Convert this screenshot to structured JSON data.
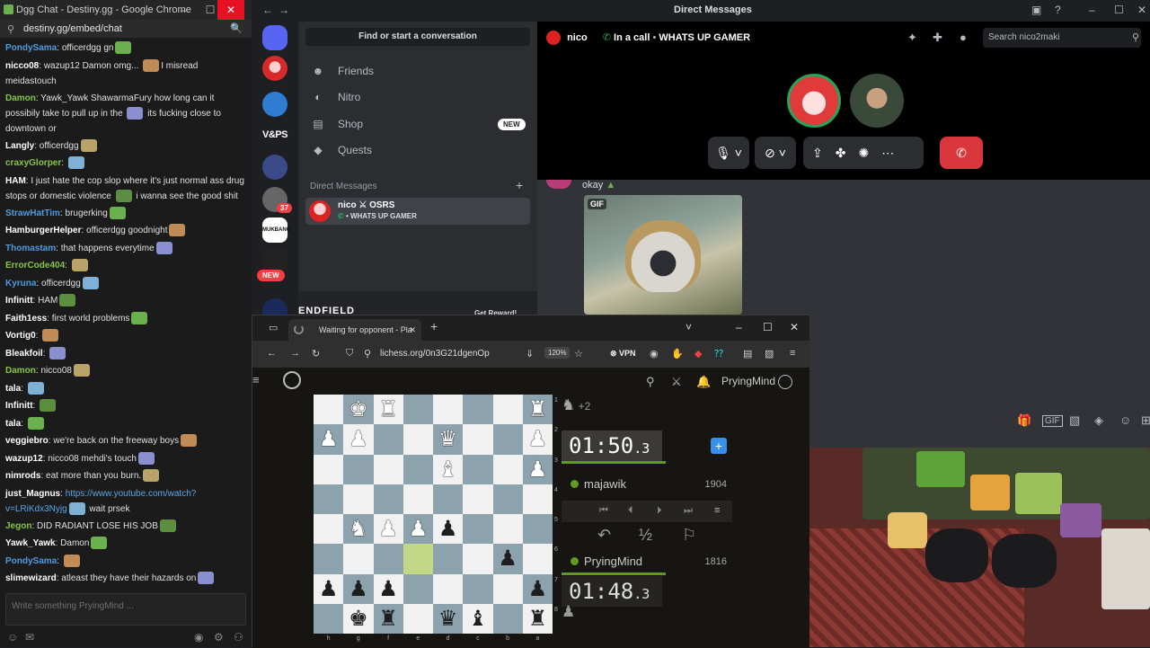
{
  "chat_window": {
    "title": "Dgg Chat - Destiny.gg - Google Chrome",
    "url": "destiny.gg/embed/chat",
    "input_placeholder": "Write something PryingMind ...",
    "messages": [
      {
        "user": "PondySama",
        "color": "#4f9be0",
        "text": "officerdgg gn"
      },
      {
        "user": "nicco08",
        "color": "#ffffff",
        "text": "wazup12 Damon omg... ",
        "text2": "I misread meidastouch",
        "wrap": true
      },
      {
        "user": "Damon",
        "color": "#86c543",
        "text": "Yawk_Yawk ShawarmaFury how long can it possibily take to pull up in the ",
        "text2": " its fucking close to downtown or",
        "wrap": true
      },
      {
        "user": "Langly",
        "color": "#ffffff",
        "text": "officerdgg"
      },
      {
        "user": "craxyGlorper",
        "color": "#86c543",
        "text": ""
      },
      {
        "user": "HAM",
        "color": "#ffffff",
        "text": "I just hate the cop slop where it's just normal ass drug stops or domestic violence ",
        "text2": " i wanna see the good shit",
        "wrap": true
      },
      {
        "user": "StrawHatTim",
        "color": "#4f9be0",
        "text": " brugerking"
      },
      {
        "user": "HamburgerHelper",
        "color": "#ffffff",
        "text": "officerdgg goodnight"
      },
      {
        "user": "Thomastam",
        "color": "#4f9be0",
        "text": " that happens everytime"
      },
      {
        "user": "ErrorCode404",
        "color": "#86c543",
        "text": ""
      },
      {
        "user": "Kyruna",
        "color": "#4f9be0",
        "text": "officerdgg"
      },
      {
        "user": "Infinitt",
        "color": "#ffffff",
        "text": "HAM"
      },
      {
        "user": "Faith1ess",
        "color": "#ffffff",
        "text": "first world problems"
      },
      {
        "user": "Vortig0",
        "color": "#ffffff",
        "text": ""
      },
      {
        "user": "Bleakfoil",
        "color": "#ffffff",
        "text": ""
      },
      {
        "user": "Damon",
        "color": "#86c543",
        "text": "nicco08"
      },
      {
        "user": "tala",
        "color": "#ffffff",
        "text": ""
      },
      {
        "user": "Infinitt",
        "color": "#ffffff",
        "text": ""
      },
      {
        "user": "tala",
        "color": "#ffffff",
        "text": ""
      },
      {
        "user": "veggiebro",
        "color": "#ffffff",
        "text": " we're back on the freeway boys"
      },
      {
        "user": "wazup12",
        "color": "#ffffff",
        "text": "nicco08 mehdi's touch"
      },
      {
        "user": "nimrods",
        "color": "#ffffff",
        "text": "eat more than you burn."
      },
      {
        "user": "just_Magnus",
        "color": "#ffffff",
        "text": "https://www.youtube.com/watch?v=LRiKdx3Nyjg",
        "text2": " wait prsek",
        "wrap": true,
        "link": true
      },
      {
        "user": "Jegon",
        "color": "#86c543",
        "text": "DID RADIANT LOSE HIS JOB"
      },
      {
        "user": "Yawk_Yawk",
        "color": "#ffffff",
        "text": "Damon"
      },
      {
        "user": "PondySama",
        "color": "#4f9be0",
        "text": ""
      },
      {
        "user": "slimewizard",
        "color": "#ffffff",
        "text": "atleast they have their hazards on"
      }
    ]
  },
  "discord": {
    "window_title": "Direct Messages",
    "search_label": "Find or start a conversation",
    "nav": [
      {
        "label": "Friends",
        "icon": "friends-icon"
      },
      {
        "label": "Nitro",
        "icon": "nitro-icon"
      },
      {
        "label": "Shop",
        "icon": "shop-icon",
        "badge": "NEW"
      },
      {
        "label": "Quests",
        "icon": "quests-icon"
      }
    ],
    "dm_header": "Direct Messages",
    "dm_entry": {
      "name": "nico",
      "tag": "OSRS",
      "status": "• WHATS UP GAMER"
    },
    "server_badges": {
      "mentions": "37",
      "new": "NEW"
    },
    "server_label": "V&PS",
    "server_label2": "MUKBANG",
    "promo": {
      "title": "ENDFIELD",
      "cta": "Get Reward!"
    },
    "call": {
      "name": "nico",
      "status": "In a call",
      "topic": "WHATS UP GAMER"
    },
    "header_search_placeholder": "Search nico2maki",
    "message_text": "okay",
    "gif_label": "GIF"
  },
  "lichess": {
    "tab_title": "Waiting for opponent - Pla",
    "url": "lichess.org/0n3G21dgenOp",
    "zoom": "120%",
    "vpn": "VPN",
    "username": "PryingMind",
    "top_material": "+2",
    "top_clock": {
      "main": "01:50",
      "tenths": ".3"
    },
    "bottom_clock": {
      "main": "01:48",
      "tenths": ".3"
    },
    "top_player": {
      "name": "majawik",
      "rating": "1904"
    },
    "bottom_player": {
      "name": "PryingMind",
      "rating": "1816"
    },
    "draw_label": "½",
    "files": [
      "h",
      "g",
      "f",
      "e",
      "d",
      "c",
      "b",
      "a"
    ],
    "ranks": [
      "1",
      "2",
      "3",
      "4",
      "5",
      "6",
      "7",
      "8"
    ],
    "board": [
      [
        "",
        "wK",
        "wR",
        "",
        "",
        "",
        "",
        "wR"
      ],
      [
        "wP",
        "wP",
        "",
        "",
        "wQ",
        "",
        "",
        "wP"
      ],
      [
        "",
        "",
        "",
        "",
        "wB",
        "",
        "",
        "wP"
      ],
      [
        "",
        "",
        "",
        "",
        "",
        "",
        "",
        ""
      ],
      [
        "",
        "wN",
        "wP",
        "wP",
        "bP",
        "",
        "",
        ""
      ],
      [
        "",
        "",
        "",
        "",
        "",
        "",
        "bP",
        ""
      ],
      [
        "bP",
        "bP",
        "bP",
        "",
        "",
        "",
        "",
        "bP"
      ],
      [
        "",
        "bK",
        "bR",
        "",
        "bQ",
        "bB",
        "",
        "bR"
      ]
    ]
  }
}
